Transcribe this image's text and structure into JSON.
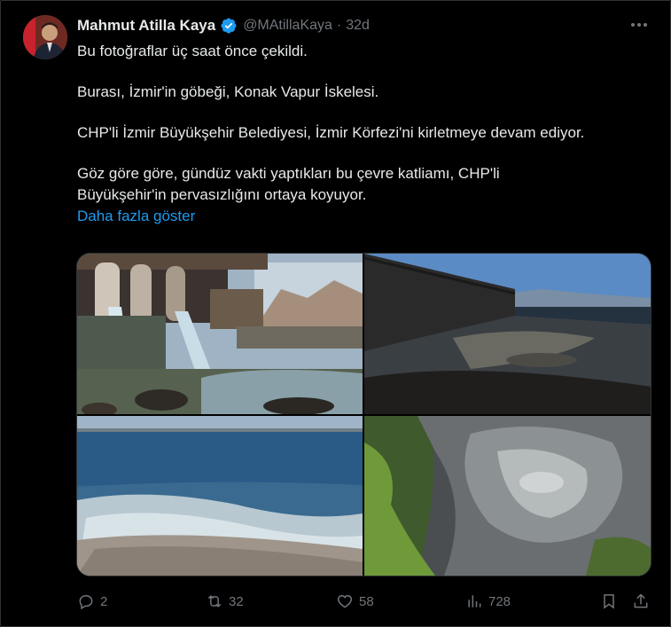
{
  "author": {
    "name": "Mahmut Atilla Kaya",
    "handle": "@MAtillaKaya",
    "separator": "·",
    "time": "32d",
    "verified": true
  },
  "tweet": {
    "line1": "Bu fotoğraflar üç saat önce çekildi.",
    "line2": "Burası, İzmir'in göbeği, Konak Vapur İskelesi.",
    "line3": "CHP'li İzmir Büyükşehir Belediyesi, İzmir Körfezi'ni kirletmeye devam ediyor.",
    "line4a": "Göz göre göre, gündüz vakti yaptıkları bu çevre katliamı, CHP'li",
    "line4b": "Büyükşehir'in pervasızlığını ortaya koyuyor.",
    "show_more": "Daha fazla göster"
  },
  "media": {
    "count": 4,
    "descriptions": [
      "pipes-discharge",
      "pier-coast",
      "sea-foam",
      "polluted-rocks"
    ]
  },
  "actions": {
    "replies": "2",
    "reposts": "32",
    "likes": "58",
    "views": "728"
  },
  "colors": {
    "background": "#000000",
    "text": "#e7e9ea",
    "muted": "#71767b",
    "link": "#1d9bf0",
    "verified": "#1d9bf0",
    "border": "#2f3336"
  },
  "icons": [
    "verified-badge-icon",
    "more-icon",
    "reply-icon",
    "repost-icon",
    "like-icon",
    "views-icon",
    "bookmark-icon",
    "share-icon"
  ]
}
